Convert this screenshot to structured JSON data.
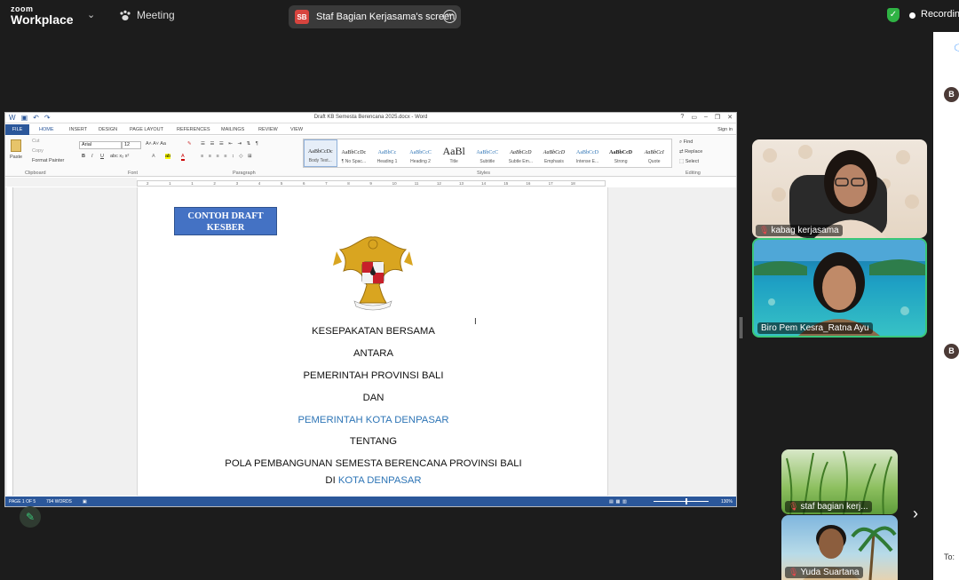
{
  "zoom": {
    "logo_line1": "zoom",
    "logo_line2": "Workplace",
    "meeting_label": "Meeting",
    "share_initials": "SB",
    "share_label": "Staf Bagian Kerjasama's screen",
    "recording_label": "Recording"
  },
  "chat": {
    "avatar1": "B",
    "avatar2": "B",
    "to_label": "To:"
  },
  "word": {
    "title": "Draft KB Semesta Berencana 2025.docx - Word",
    "win_controls": [
      "?",
      "▭",
      "–",
      "❐",
      "✕"
    ],
    "tabs": [
      "FILE",
      "HOME",
      "INSERT",
      "DESIGN",
      "PAGE LAYOUT",
      "REFERENCES",
      "MAILINGS",
      "REVIEW",
      "VIEW"
    ],
    "sign_in": "Sign in",
    "clipboard": {
      "paste": "Paste",
      "cut": "Cut",
      "copy": "Copy",
      "format_painter": "Format Painter",
      "label": "Clipboard"
    },
    "font": {
      "name": "Arial",
      "size": "12",
      "label": "Font"
    },
    "paragraph_label": "Paragraph",
    "styles_label": "Styles",
    "styles": [
      {
        "sample": "AaBbCcDc",
        "name": "Body Text..."
      },
      {
        "sample": "AaBbCcDc",
        "name": "¶ No Spac..."
      },
      {
        "sample": "AaBbCc",
        "name": "Heading 1"
      },
      {
        "sample": "AaBbCcC",
        "name": "Heading 2"
      },
      {
        "sample": "AaBl",
        "name": "Title"
      },
      {
        "sample": "AaBbCcC",
        "name": "Subtitle"
      },
      {
        "sample": "AaBbCcD",
        "name": "Subtle Em..."
      },
      {
        "sample": "AaBbCcD",
        "name": "Emphasis"
      },
      {
        "sample": "AaBbCcD",
        "name": "Intense E..."
      },
      {
        "sample": "AaBbCcD",
        "name": "Strong"
      },
      {
        "sample": "AaBbCcI",
        "name": "Quote"
      }
    ],
    "editing": {
      "find": "Find",
      "replace": "Replace",
      "select": "Select",
      "label": "Editing"
    },
    "ruler_ticks": [
      "2",
      "1",
      "1",
      "2",
      "3",
      "4",
      "5",
      "6",
      "7",
      "8",
      "9",
      "10",
      "11",
      "12",
      "13",
      "14",
      "15",
      "16",
      "17",
      "18"
    ],
    "status": {
      "page": "PAGE 1 OF 5",
      "words": "794 WORDS",
      "zoom": "130%"
    }
  },
  "document": {
    "draft_label_1": "CONTOH DRAFT",
    "draft_label_2": "KESBER",
    "line1": "KESEPAKATAN BERSAMA",
    "line2": "ANTARA",
    "line3": "PEMERINTAH PROVINSI BALI",
    "line4": "DAN",
    "line5": "PEMERINTAH KOTA DENPASAR",
    "line6": "TENTANG",
    "line7": "POLA PEMBANGUNAN SEMESTA BERENCANA PROVINSI BALI",
    "line8_prefix": "DI ",
    "line8_blue": "KOTA DENPASAR"
  },
  "participants": [
    {
      "name": "kabag kerjasama"
    },
    {
      "name": "Biro Pem Kesra_Ratna Ayu"
    },
    {
      "name": "staf bagian kerj..."
    },
    {
      "name": "Yuda Suartana"
    }
  ],
  "colors": {
    "word_blue": "#2b579a",
    "doc_blue": "#2e75b6",
    "active_speaker": "#3bc779",
    "recording_shield": "#2fb344"
  }
}
